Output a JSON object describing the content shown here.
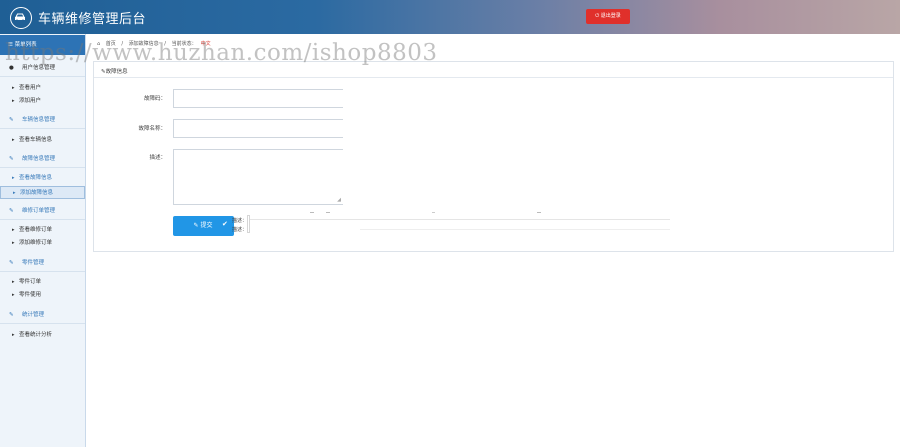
{
  "header": {
    "app_title": "车辆维修管理后台",
    "logout_label": "⏻ 退出登录",
    "logo_icon": "car-icon"
  },
  "sidebar": {
    "top_item": "☰ 菜单列表",
    "groups": [
      {
        "icon": "user-icon",
        "label": "用户信息管理",
        "items": [
          "查看用户",
          "添加用户"
        ]
      },
      {
        "icon": "edit-icon",
        "label": "车辆信息管理",
        "items": [
          "查看车辆信息"
        ]
      },
      {
        "icon": "edit-icon",
        "label": "故障信息管理",
        "items": [
          "查看故障信息",
          "添加故障信息"
        ]
      },
      {
        "icon": "edit-icon",
        "label": "维修订单管理",
        "items": [
          "查看维修订单",
          "添加维修订单"
        ]
      },
      {
        "icon": "edit-icon",
        "label": "零件管理",
        "items": [
          "零件订单",
          "零件使用"
        ]
      },
      {
        "icon": "edit-icon",
        "label": "统计管理",
        "items": [
          "查看统计分析"
        ]
      }
    ]
  },
  "breadcrumb": {
    "home": "首页",
    "section": "添加故障信息",
    "current_label": "当前状态：",
    "current_value": "中文"
  },
  "panel": {
    "title": "故障信息",
    "fields": {
      "code_label": "故障码：",
      "name_label": "故障名称：",
      "desc_label": "描述："
    },
    "submit_label": "提交",
    "artifact_labels": [
      "描述：",
      "描述："
    ]
  },
  "watermark": "https://www.huzhan.com/ishop8803",
  "colors": {
    "header_start": "#1f5f95",
    "header_end": "#b9a6a6",
    "sidebar_head": "#2d73b5",
    "accent": "#3779b9",
    "submit": "#2196e6",
    "logout": "#e0302b"
  }
}
